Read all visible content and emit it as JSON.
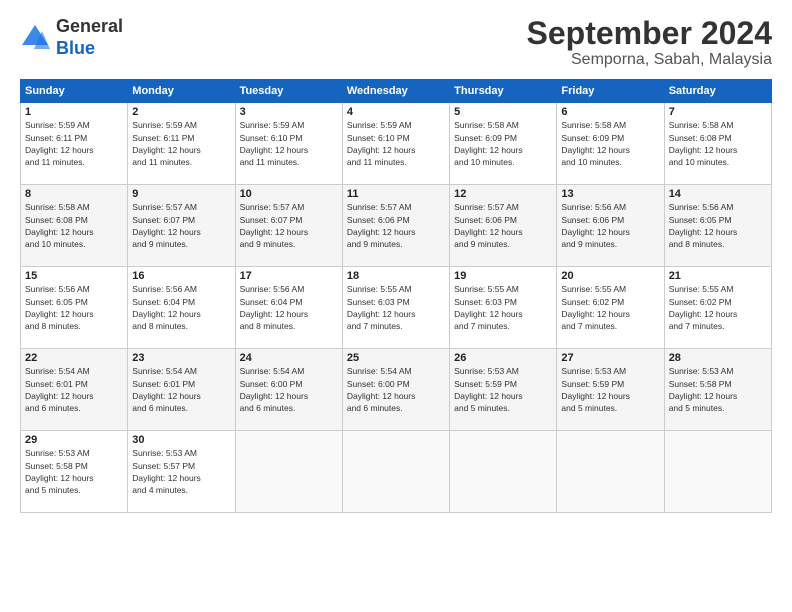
{
  "header": {
    "logo_general": "General",
    "logo_blue": "Blue",
    "month_title": "September 2024",
    "subtitle": "Semporna, Sabah, Malaysia"
  },
  "days_of_week": [
    "Sunday",
    "Monday",
    "Tuesday",
    "Wednesday",
    "Thursday",
    "Friday",
    "Saturday"
  ],
  "weeks": [
    [
      {
        "day": 1,
        "info": "Sunrise: 5:59 AM\nSunset: 6:11 PM\nDaylight: 12 hours\nand 11 minutes."
      },
      {
        "day": 2,
        "info": "Sunrise: 5:59 AM\nSunset: 6:11 PM\nDaylight: 12 hours\nand 11 minutes."
      },
      {
        "day": 3,
        "info": "Sunrise: 5:59 AM\nSunset: 6:10 PM\nDaylight: 12 hours\nand 11 minutes."
      },
      {
        "day": 4,
        "info": "Sunrise: 5:59 AM\nSunset: 6:10 PM\nDaylight: 12 hours\nand 11 minutes."
      },
      {
        "day": 5,
        "info": "Sunrise: 5:58 AM\nSunset: 6:09 PM\nDaylight: 12 hours\nand 10 minutes."
      },
      {
        "day": 6,
        "info": "Sunrise: 5:58 AM\nSunset: 6:09 PM\nDaylight: 12 hours\nand 10 minutes."
      },
      {
        "day": 7,
        "info": "Sunrise: 5:58 AM\nSunset: 6:08 PM\nDaylight: 12 hours\nand 10 minutes."
      }
    ],
    [
      {
        "day": 8,
        "info": "Sunrise: 5:58 AM\nSunset: 6:08 PM\nDaylight: 12 hours\nand 10 minutes."
      },
      {
        "day": 9,
        "info": "Sunrise: 5:57 AM\nSunset: 6:07 PM\nDaylight: 12 hours\nand 9 minutes."
      },
      {
        "day": 10,
        "info": "Sunrise: 5:57 AM\nSunset: 6:07 PM\nDaylight: 12 hours\nand 9 minutes."
      },
      {
        "day": 11,
        "info": "Sunrise: 5:57 AM\nSunset: 6:06 PM\nDaylight: 12 hours\nand 9 minutes."
      },
      {
        "day": 12,
        "info": "Sunrise: 5:57 AM\nSunset: 6:06 PM\nDaylight: 12 hours\nand 9 minutes."
      },
      {
        "day": 13,
        "info": "Sunrise: 5:56 AM\nSunset: 6:06 PM\nDaylight: 12 hours\nand 9 minutes."
      },
      {
        "day": 14,
        "info": "Sunrise: 5:56 AM\nSunset: 6:05 PM\nDaylight: 12 hours\nand 8 minutes."
      }
    ],
    [
      {
        "day": 15,
        "info": "Sunrise: 5:56 AM\nSunset: 6:05 PM\nDaylight: 12 hours\nand 8 minutes."
      },
      {
        "day": 16,
        "info": "Sunrise: 5:56 AM\nSunset: 6:04 PM\nDaylight: 12 hours\nand 8 minutes."
      },
      {
        "day": 17,
        "info": "Sunrise: 5:56 AM\nSunset: 6:04 PM\nDaylight: 12 hours\nand 8 minutes."
      },
      {
        "day": 18,
        "info": "Sunrise: 5:55 AM\nSunset: 6:03 PM\nDaylight: 12 hours\nand 7 minutes."
      },
      {
        "day": 19,
        "info": "Sunrise: 5:55 AM\nSunset: 6:03 PM\nDaylight: 12 hours\nand 7 minutes."
      },
      {
        "day": 20,
        "info": "Sunrise: 5:55 AM\nSunset: 6:02 PM\nDaylight: 12 hours\nand 7 minutes."
      },
      {
        "day": 21,
        "info": "Sunrise: 5:55 AM\nSunset: 6:02 PM\nDaylight: 12 hours\nand 7 minutes."
      }
    ],
    [
      {
        "day": 22,
        "info": "Sunrise: 5:54 AM\nSunset: 6:01 PM\nDaylight: 12 hours\nand 6 minutes."
      },
      {
        "day": 23,
        "info": "Sunrise: 5:54 AM\nSunset: 6:01 PM\nDaylight: 12 hours\nand 6 minutes."
      },
      {
        "day": 24,
        "info": "Sunrise: 5:54 AM\nSunset: 6:00 PM\nDaylight: 12 hours\nand 6 minutes."
      },
      {
        "day": 25,
        "info": "Sunrise: 5:54 AM\nSunset: 6:00 PM\nDaylight: 12 hours\nand 6 minutes."
      },
      {
        "day": 26,
        "info": "Sunrise: 5:53 AM\nSunset: 5:59 PM\nDaylight: 12 hours\nand 5 minutes."
      },
      {
        "day": 27,
        "info": "Sunrise: 5:53 AM\nSunset: 5:59 PM\nDaylight: 12 hours\nand 5 minutes."
      },
      {
        "day": 28,
        "info": "Sunrise: 5:53 AM\nSunset: 5:58 PM\nDaylight: 12 hours\nand 5 minutes."
      }
    ],
    [
      {
        "day": 29,
        "info": "Sunrise: 5:53 AM\nSunset: 5:58 PM\nDaylight: 12 hours\nand 5 minutes."
      },
      {
        "day": 30,
        "info": "Sunrise: 5:53 AM\nSunset: 5:57 PM\nDaylight: 12 hours\nand 4 minutes."
      },
      null,
      null,
      null,
      null,
      null
    ]
  ]
}
